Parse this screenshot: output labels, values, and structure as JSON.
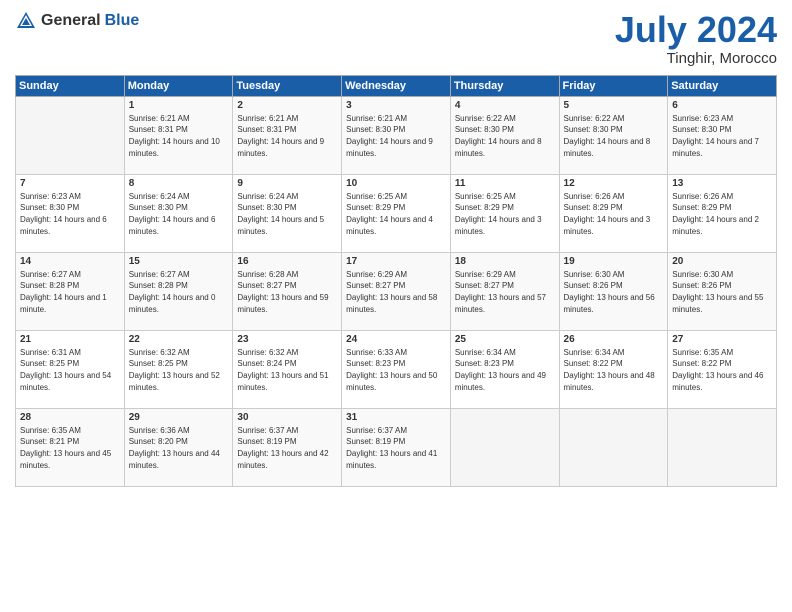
{
  "header": {
    "logo_general": "General",
    "logo_blue": "Blue",
    "month_year": "July 2024",
    "location": "Tinghir, Morocco"
  },
  "weekdays": [
    "Sunday",
    "Monday",
    "Tuesday",
    "Wednesday",
    "Thursday",
    "Friday",
    "Saturday"
  ],
  "weeks": [
    [
      {
        "day": "",
        "empty": true
      },
      {
        "day": "1",
        "sunrise": "6:21 AM",
        "sunset": "8:31 PM",
        "daylight": "14 hours and 10 minutes."
      },
      {
        "day": "2",
        "sunrise": "6:21 AM",
        "sunset": "8:31 PM",
        "daylight": "14 hours and 9 minutes."
      },
      {
        "day": "3",
        "sunrise": "6:21 AM",
        "sunset": "8:30 PM",
        "daylight": "14 hours and 9 minutes."
      },
      {
        "day": "4",
        "sunrise": "6:22 AM",
        "sunset": "8:30 PM",
        "daylight": "14 hours and 8 minutes."
      },
      {
        "day": "5",
        "sunrise": "6:22 AM",
        "sunset": "8:30 PM",
        "daylight": "14 hours and 8 minutes."
      },
      {
        "day": "6",
        "sunrise": "6:23 AM",
        "sunset": "8:30 PM",
        "daylight": "14 hours and 7 minutes."
      }
    ],
    [
      {
        "day": "7",
        "sunrise": "6:23 AM",
        "sunset": "8:30 PM",
        "daylight": "14 hours and 6 minutes."
      },
      {
        "day": "8",
        "sunrise": "6:24 AM",
        "sunset": "8:30 PM",
        "daylight": "14 hours and 6 minutes."
      },
      {
        "day": "9",
        "sunrise": "6:24 AM",
        "sunset": "8:30 PM",
        "daylight": "14 hours and 5 minutes."
      },
      {
        "day": "10",
        "sunrise": "6:25 AM",
        "sunset": "8:29 PM",
        "daylight": "14 hours and 4 minutes."
      },
      {
        "day": "11",
        "sunrise": "6:25 AM",
        "sunset": "8:29 PM",
        "daylight": "14 hours and 3 minutes."
      },
      {
        "day": "12",
        "sunrise": "6:26 AM",
        "sunset": "8:29 PM",
        "daylight": "14 hours and 3 minutes."
      },
      {
        "day": "13",
        "sunrise": "6:26 AM",
        "sunset": "8:29 PM",
        "daylight": "14 hours and 2 minutes."
      }
    ],
    [
      {
        "day": "14",
        "sunrise": "6:27 AM",
        "sunset": "8:28 PM",
        "daylight": "14 hours and 1 minute."
      },
      {
        "day": "15",
        "sunrise": "6:27 AM",
        "sunset": "8:28 PM",
        "daylight": "14 hours and 0 minutes."
      },
      {
        "day": "16",
        "sunrise": "6:28 AM",
        "sunset": "8:27 PM",
        "daylight": "13 hours and 59 minutes."
      },
      {
        "day": "17",
        "sunrise": "6:29 AM",
        "sunset": "8:27 PM",
        "daylight": "13 hours and 58 minutes."
      },
      {
        "day": "18",
        "sunrise": "6:29 AM",
        "sunset": "8:27 PM",
        "daylight": "13 hours and 57 minutes."
      },
      {
        "day": "19",
        "sunrise": "6:30 AM",
        "sunset": "8:26 PM",
        "daylight": "13 hours and 56 minutes."
      },
      {
        "day": "20",
        "sunrise": "6:30 AM",
        "sunset": "8:26 PM",
        "daylight": "13 hours and 55 minutes."
      }
    ],
    [
      {
        "day": "21",
        "sunrise": "6:31 AM",
        "sunset": "8:25 PM",
        "daylight": "13 hours and 54 minutes."
      },
      {
        "day": "22",
        "sunrise": "6:32 AM",
        "sunset": "8:25 PM",
        "daylight": "13 hours and 52 minutes."
      },
      {
        "day": "23",
        "sunrise": "6:32 AM",
        "sunset": "8:24 PM",
        "daylight": "13 hours and 51 minutes."
      },
      {
        "day": "24",
        "sunrise": "6:33 AM",
        "sunset": "8:23 PM",
        "daylight": "13 hours and 50 minutes."
      },
      {
        "day": "25",
        "sunrise": "6:34 AM",
        "sunset": "8:23 PM",
        "daylight": "13 hours and 49 minutes."
      },
      {
        "day": "26",
        "sunrise": "6:34 AM",
        "sunset": "8:22 PM",
        "daylight": "13 hours and 48 minutes."
      },
      {
        "day": "27",
        "sunrise": "6:35 AM",
        "sunset": "8:22 PM",
        "daylight": "13 hours and 46 minutes."
      }
    ],
    [
      {
        "day": "28",
        "sunrise": "6:35 AM",
        "sunset": "8:21 PM",
        "daylight": "13 hours and 45 minutes."
      },
      {
        "day": "29",
        "sunrise": "6:36 AM",
        "sunset": "8:20 PM",
        "daylight": "13 hours and 44 minutes."
      },
      {
        "day": "30",
        "sunrise": "6:37 AM",
        "sunset": "8:19 PM",
        "daylight": "13 hours and 42 minutes."
      },
      {
        "day": "31",
        "sunrise": "6:37 AM",
        "sunset": "8:19 PM",
        "daylight": "13 hours and 41 minutes."
      },
      {
        "day": "",
        "empty": true
      },
      {
        "day": "",
        "empty": true
      },
      {
        "day": "",
        "empty": true
      }
    ]
  ]
}
